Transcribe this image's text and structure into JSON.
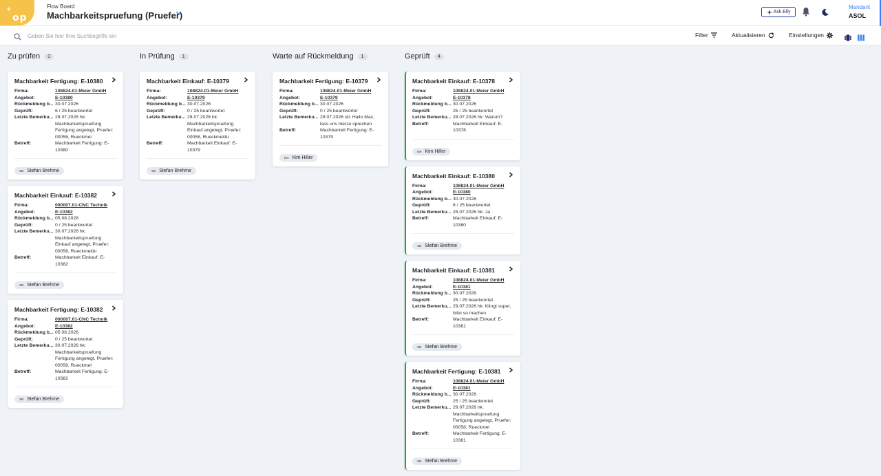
{
  "app": {
    "logo_text": "op",
    "logo_sup": "+"
  },
  "header": {
    "breadcrumb": "Flow Board",
    "title": "Machbarkeitspruefung (Pruefer)",
    "ask_label": "Ask Elly",
    "mandant_label": "Mandant",
    "mandant_value": "ASOL",
    "icons": [
      "chevron-down-icon",
      "sparkle-icon",
      "bell-icon",
      "moon-icon"
    ]
  },
  "toolbar": {
    "search_placeholder": "Geben Sie hier Ihre Suchbegriffe ein",
    "filter_label": "Filter",
    "refresh_label": "Aktualisieren",
    "settings_label": "Einstellungen",
    "icons": [
      "search-icon",
      "filter-icon",
      "refresh-icon",
      "gear-icon",
      "list-view-icon",
      "board-view-icon"
    ]
  },
  "labels": {
    "firma": "Firma:",
    "angebot": "Angebot:",
    "rueckmeldung": "Rückmeldung b...",
    "geprueft": "Geprüft:",
    "bemerkung": "Letzte Bemerku...",
    "betreff": "Betreff:"
  },
  "colors": {
    "accent": "#3b82f6",
    "done_border": "#22a33a",
    "logo": "#f6c24a"
  },
  "columns": [
    {
      "title": "Zu prüfen",
      "count": "3",
      "cards": [
        {
          "title": "Machbarkeit Fertigung: E-10380",
          "firma": "108824.01-Meier GmbH",
          "angebot": "E-10380",
          "rueckmeldung": "30.07.2026",
          "geprueft": "6 / 25 beantwortet",
          "bemerkung": "28.07.2026 hk: Machbarkeitspruefung Fertigung angelegt, Pruefer: 00058, Rueckmel",
          "betreff": "Machbarkeit Fertigung: E-10380",
          "initials": "SB",
          "assignee": "Stefan Brehme"
        },
        {
          "title": "Machbarkeit Einkauf: E-10382",
          "firma": "000007.01-CNC Technik",
          "angebot": "E-10382",
          "rueckmeldung": "05.08.2026",
          "geprueft": "0 / 25 beantwortet",
          "bemerkung": "30.07.2026 hk: Machbarkeitspruefung Einkauf angelegt, Pruefer: 00058, Rueckmeldu",
          "betreff": "Machbarkeit Einkauf: E-10382",
          "initials": "SB",
          "assignee": "Stefan Brehme"
        },
        {
          "title": "Machbarkeit Fertigung: E-10382",
          "firma": "000007.01-CNC Technik",
          "angebot": "E-10382",
          "rueckmeldung": "05.08.2026",
          "geprueft": "0 / 25 beantwortet",
          "bemerkung": "30.07.2026 hk: Machbarkeitspruefung Fertigung angelegt, Pruefer: 00058, Rueckmel",
          "betreff": "Machbarkeit Fertigung: E-10382",
          "initials": "SB",
          "assignee": "Stefan Brehme"
        }
      ]
    },
    {
      "title": "In Prüfung",
      "count": "1",
      "cards": [
        {
          "title": "Machbarkeit Einkauf: E-10379",
          "firma": "108824.01-Meier GmbH",
          "angebot": "E-10379",
          "rueckmeldung": "30.07.2026",
          "geprueft": "0 / 25 beantwortet",
          "bemerkung": "28.07.2026 hk: Machbarkeitspruefung Einkauf angelegt, Pruefer: 00058, Rueckmeldu",
          "betreff": "Machbarkeit Einkauf: E-10379",
          "initials": "SB",
          "assignee": "Stefan Brehme"
        }
      ]
    },
    {
      "title": "Warte auf Rückmeldung",
      "count": "1",
      "cards": [
        {
          "title": "Machbarkeit Fertigung: E-10379",
          "firma": "108824.01-Meier GmbH",
          "angebot": "E-10379",
          "rueckmeldung": "30.07.2026",
          "geprueft": "0 / 25 beantwortet",
          "bemerkung": "29.07.2026 sb: Hallo Max, lass uns hierzu sprechen",
          "betreff": "Machbarkeit Fertigung: E-10379",
          "initials": "KH",
          "assignee": "Kim Hiller"
        }
      ]
    },
    {
      "title": "Geprüft",
      "count": "4",
      "cards": [
        {
          "title": "Machbarkeit Einkauf: E-10378",
          "firma": "108824.01-Meier GmbH",
          "angebot": "E-10378",
          "rueckmeldung": "30.07.2026",
          "geprueft": "25 / 25 beantwortet",
          "bemerkung": "28.07.2026 hk: Warum?",
          "betreff": "Machbarkeit Einkauf: E-10378",
          "initials": "KH",
          "assignee": "Kim Hiller"
        },
        {
          "title": "Machbarkeit Einkauf: E-10380",
          "firma": "108824.01-Meier GmbH",
          "angebot": "E-10380",
          "rueckmeldung": "30.07.2026",
          "geprueft": "6 / 25 beantwortet",
          "bemerkung": "28.07.2026 hk: Ja",
          "betreff": "Machbarkeit Einkauf: E-10380",
          "initials": "SB",
          "assignee": "Stefan Brehme"
        },
        {
          "title": "Machbarkeit Einkauf: E-10381",
          "firma": "108824.01-Meier GmbH",
          "angebot": "E-10381",
          "rueckmeldung": "30.07.2026",
          "geprueft": "25 / 25 beantwortet",
          "bemerkung": "29.07.2026 hk: Klingt super, bitte so machen",
          "betreff": "Machbarkeit Einkauf: E-10381",
          "initials": "SB",
          "assignee": "Stefan Brehme"
        },
        {
          "title": "Machbarkeit Fertigung: E-10381",
          "firma": "108824.01-Meier GmbH",
          "angebot": "E-10381",
          "rueckmeldung": "30.07.2026",
          "geprueft": "25 / 25 beantwortet",
          "bemerkung": "29.07.2026 hk: Machbarkeitspruefung Fertigung angelegt, Pruefer: 00058, Rueckmel",
          "betreff": "Machbarkeit Fertigung: E-10381",
          "initials": "SB",
          "assignee": "Stefan Brehme"
        }
      ]
    }
  ]
}
